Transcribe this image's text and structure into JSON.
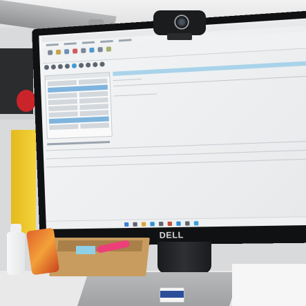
{
  "scene": {
    "monitor_brand": "DELL"
  }
}
